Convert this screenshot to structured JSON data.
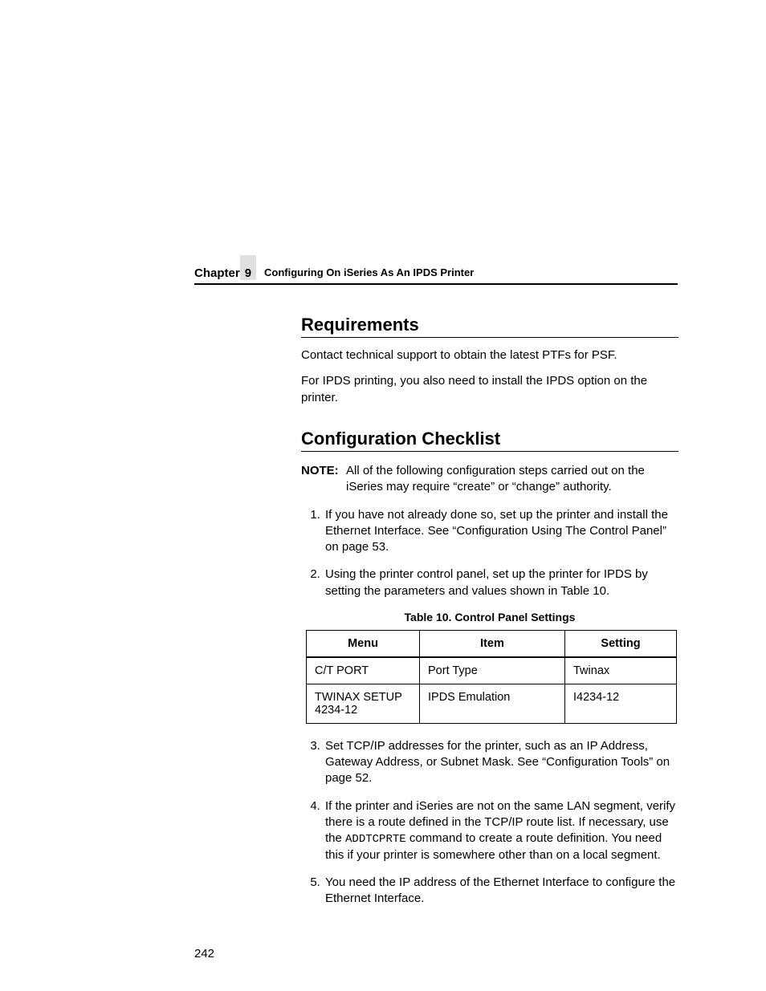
{
  "header": {
    "chapter_word": "Chapter",
    "chapter_number": "9",
    "chapter_title": "Configuring On iSeries As An IPDS Printer"
  },
  "sections": {
    "requirements": {
      "heading": "Requirements",
      "p1": "Contact technical support to obtain the latest PTFs for PSF.",
      "p2": "For IPDS printing, you also need to install the IPDS option on the printer."
    },
    "checklist": {
      "heading": "Configuration Checklist",
      "note_label": "NOTE:",
      "note_text": "All of the following configuration steps carried out on the iSeries may require “create” or “change” authority.",
      "step1": "If you have not already done so, set up the printer and install the Ethernet Interface. See “Configuration Using The Control Panel” on page 53.",
      "step2": "Using the printer control panel, set up the printer for IPDS by setting the parameters and values shown in Table 10.",
      "table": {
        "caption": "Table 10. Control Panel Settings",
        "headers": {
          "menu": "Menu",
          "item": "Item",
          "setting": "Setting"
        },
        "rows": [
          {
            "menu": "C/T PORT",
            "item": "Port Type",
            "setting": "Twinax"
          },
          {
            "menu": "TWINAX SETUP 4234-12",
            "item": "IPDS Emulation",
            "setting": "I4234-12"
          }
        ]
      },
      "step3": "Set TCP/IP addresses for the printer, such as an IP Address, Gateway Address, or Subnet Mask. See “Configuration Tools” on page 52.",
      "step4_a": "If the printer and iSeries are not on the same LAN segment, verify there is a route defined in the TCP/IP route list. If necessary, use the ",
      "step4_cmd": "ADDTCPRTE",
      "step4_b": " command to create a route definition. You need this if your printer is somewhere other than on a local segment.",
      "step5": "You need the IP address of the Ethernet Interface to configure the Ethernet Interface."
    }
  },
  "page_number": "242"
}
